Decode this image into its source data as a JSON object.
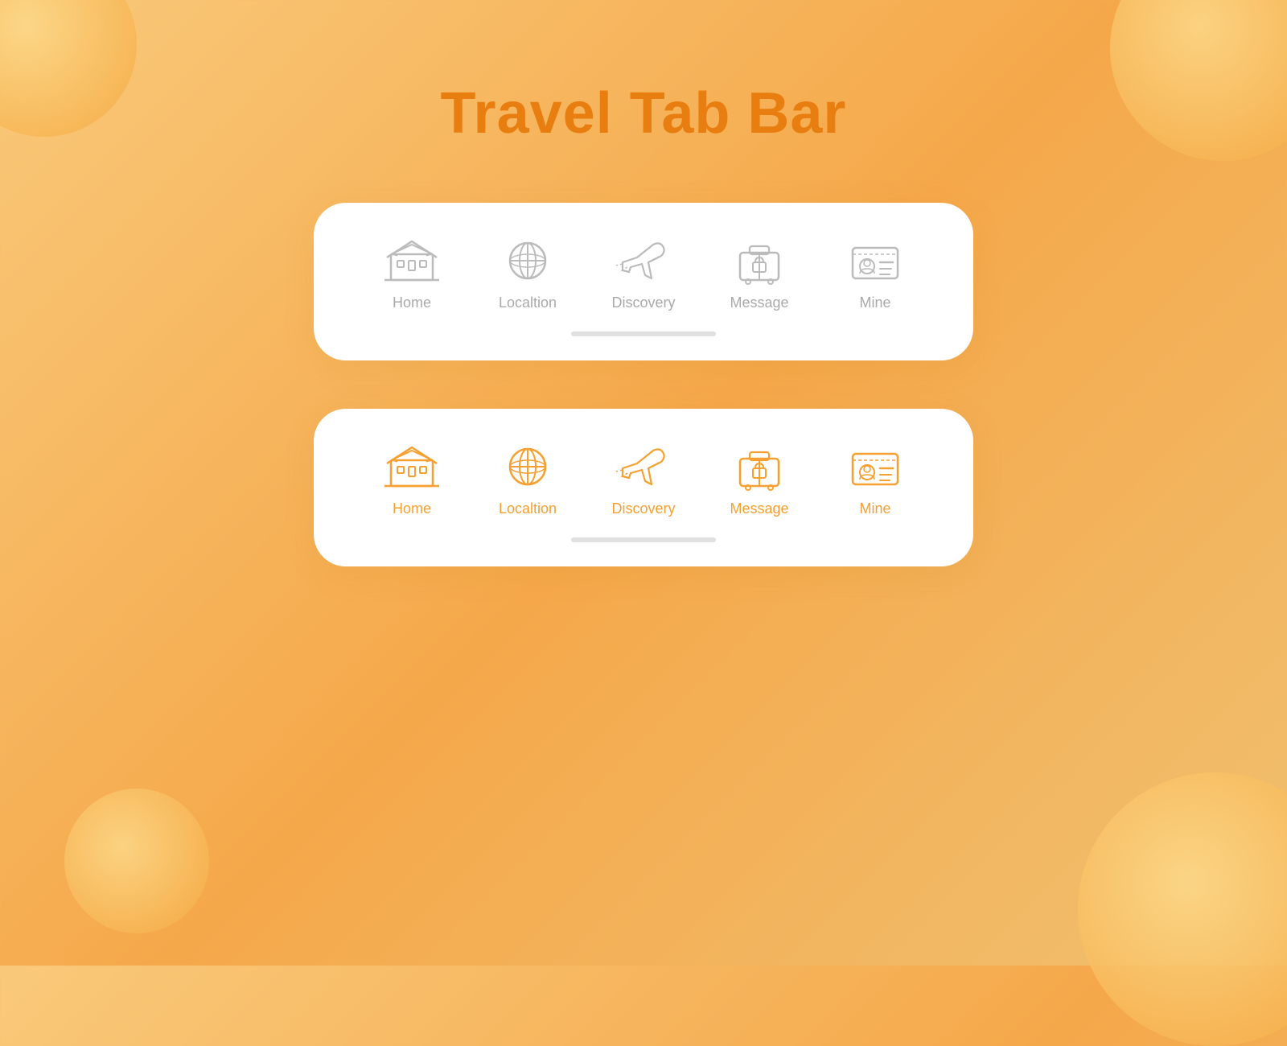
{
  "page": {
    "title": "Travel Tab Bar",
    "background_color": "#f5a84a"
  },
  "tab_bars": [
    {
      "id": "inactive",
      "active_tab": "discovery",
      "tabs": [
        {
          "id": "home",
          "label": "Home"
        },
        {
          "id": "location",
          "label": "Localtion"
        },
        {
          "id": "discovery",
          "label": "Discovery"
        },
        {
          "id": "message",
          "label": "Message"
        },
        {
          "id": "mine",
          "label": "Mine"
        }
      ]
    },
    {
      "id": "active",
      "active_tab": "discovery",
      "tabs": [
        {
          "id": "home",
          "label": "Home"
        },
        {
          "id": "location",
          "label": "Localtion"
        },
        {
          "id": "discovery",
          "label": "Discovery"
        },
        {
          "id": "message",
          "label": "Message"
        },
        {
          "id": "mine",
          "label": "Mine"
        }
      ]
    }
  ],
  "accent_color": "#f5a030",
  "inactive_color": "#bbbbbb"
}
